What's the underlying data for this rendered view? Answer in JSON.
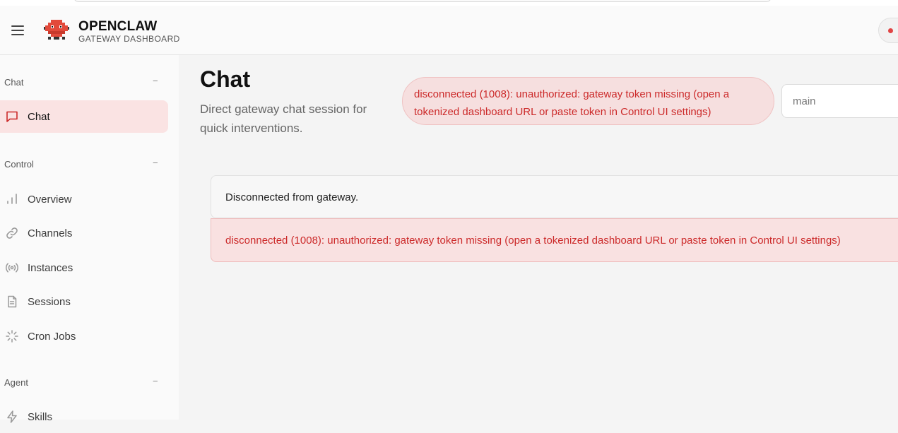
{
  "app": {
    "brand_title": "OPENCLAW",
    "brand_subtitle": "GATEWAY DASHBOARD"
  },
  "colors": {
    "accent": "#e04444",
    "error_text": "#cc2a2a",
    "error_bg": "#f6dfdf",
    "active_nav_bg": "#fae3e3"
  },
  "sidebar": {
    "groups": [
      {
        "label": "Chat",
        "toggle": "−",
        "items": [
          {
            "label": "Chat",
            "icon": "message-square-icon",
            "active": true
          }
        ]
      },
      {
        "label": "Control",
        "toggle": "−",
        "items": [
          {
            "label": "Overview",
            "icon": "bar-chart-icon"
          },
          {
            "label": "Channels",
            "icon": "link-icon"
          },
          {
            "label": "Instances",
            "icon": "radio-broadcast-icon"
          },
          {
            "label": "Sessions",
            "icon": "file-text-icon"
          },
          {
            "label": "Cron Jobs",
            "icon": "loader-icon"
          }
        ]
      },
      {
        "label": "Agent",
        "toggle": "−",
        "items": [
          {
            "label": "Skills",
            "icon": "zap-icon"
          }
        ]
      }
    ]
  },
  "main": {
    "title": "Chat",
    "subtitle": "Direct gateway chat session for quick interventions.",
    "error_pill": "disconnected (1008): unauthorized: gateway token missing (open a tokenized dashboard URL or paste token in Control UI settings)",
    "session_input": {
      "value": "",
      "placeholder": "main"
    },
    "notice": "Disconnected from gateway.",
    "notice_error": "disconnected (1008): unauthorized: gateway token missing (open a tokenized dashboard URL or paste token in Control UI settings)"
  },
  "status": {
    "connected": false
  }
}
